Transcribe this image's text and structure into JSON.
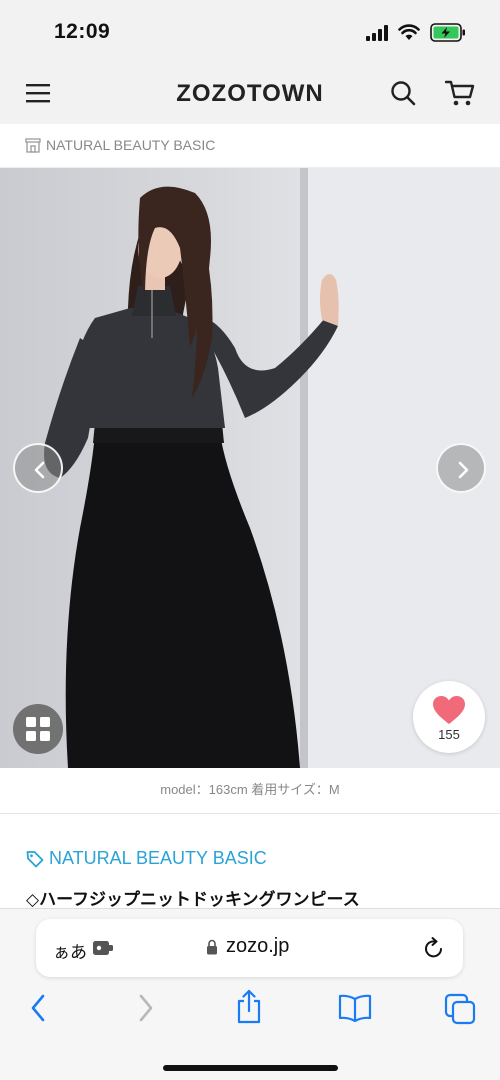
{
  "status_bar": {
    "time": "12:09"
  },
  "app_header": {
    "logo": "ZOZOTOWN"
  },
  "brand_bar": {
    "label": "NATURAL BEAUTY BASIC"
  },
  "hero": {
    "favorite_count": "155"
  },
  "caption": {
    "text": "model：163cm 着用サイズ：M"
  },
  "product": {
    "brand": "NATURAL BEAUTY BASIC",
    "title": "◇ハーフジップニットドッキングワンピース"
  },
  "browser": {
    "text_size_label": "ぁあ",
    "url": "zozo.jp"
  },
  "colors": {
    "brand_link": "#2aa3d6",
    "ios_blue": "#1a7cf5",
    "heart": "#f06a7a"
  }
}
